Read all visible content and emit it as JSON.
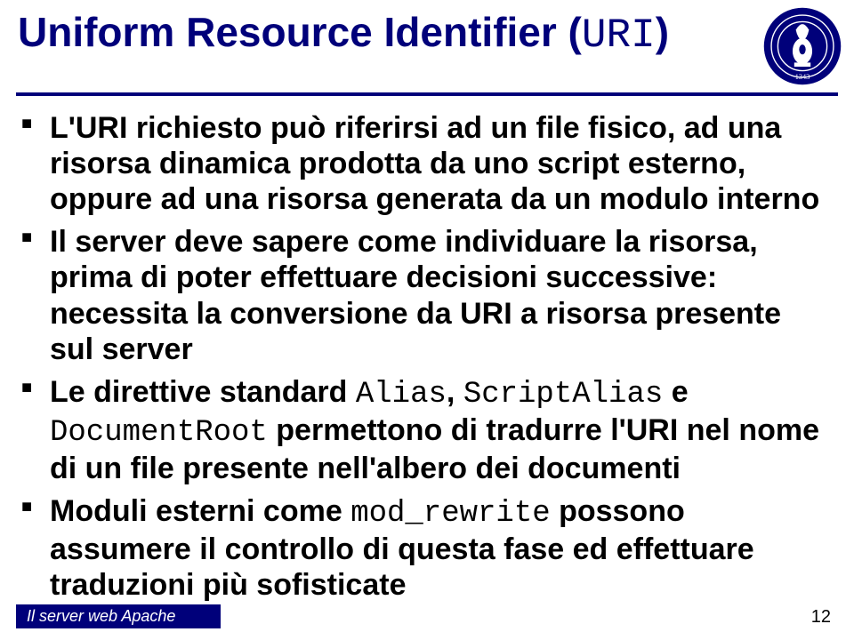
{
  "title_pre": "Uniform Resource Identifier (",
  "title_mono": "URI",
  "title_post": ")",
  "bullets": [
    {
      "spans": [
        {
          "t": "L'URI richiesto può riferirsi ad un file fisico, ad una risorsa dinamica prodotta da uno script esterno, oppure ad una risorsa generata da un modulo interno"
        }
      ]
    },
    {
      "spans": [
        {
          "t": "Il server deve sapere come individuare la risorsa, prima di poter effettuare decisioni successive: necessita la conversione da URI a risorsa presente sul server"
        }
      ]
    },
    {
      "spans": [
        {
          "t": "Le direttive standard "
        },
        {
          "t": "Alias",
          "mono": true
        },
        {
          "t": ", "
        },
        {
          "t": "ScriptAlias",
          "mono": true
        },
        {
          "t": " e "
        },
        {
          "t": "DocumentRoot",
          "mono": true
        },
        {
          "t": " permettono di tradurre l'URI nel nome di un file presente nell'albero dei documenti"
        }
      ]
    },
    {
      "spans": [
        {
          "t": "Moduli esterni come "
        },
        {
          "t": "mod_rewrite",
          "mono": true
        },
        {
          "t": " possono assumere il controllo di questa fase ed effettuare traduzioni più sofisticate"
        }
      ]
    }
  ],
  "footer_text": "Il server web Apache",
  "page_number": "12",
  "logo_motto_top": "SAPIENTIAE DIGNITAS",
  "logo_year": "1343"
}
